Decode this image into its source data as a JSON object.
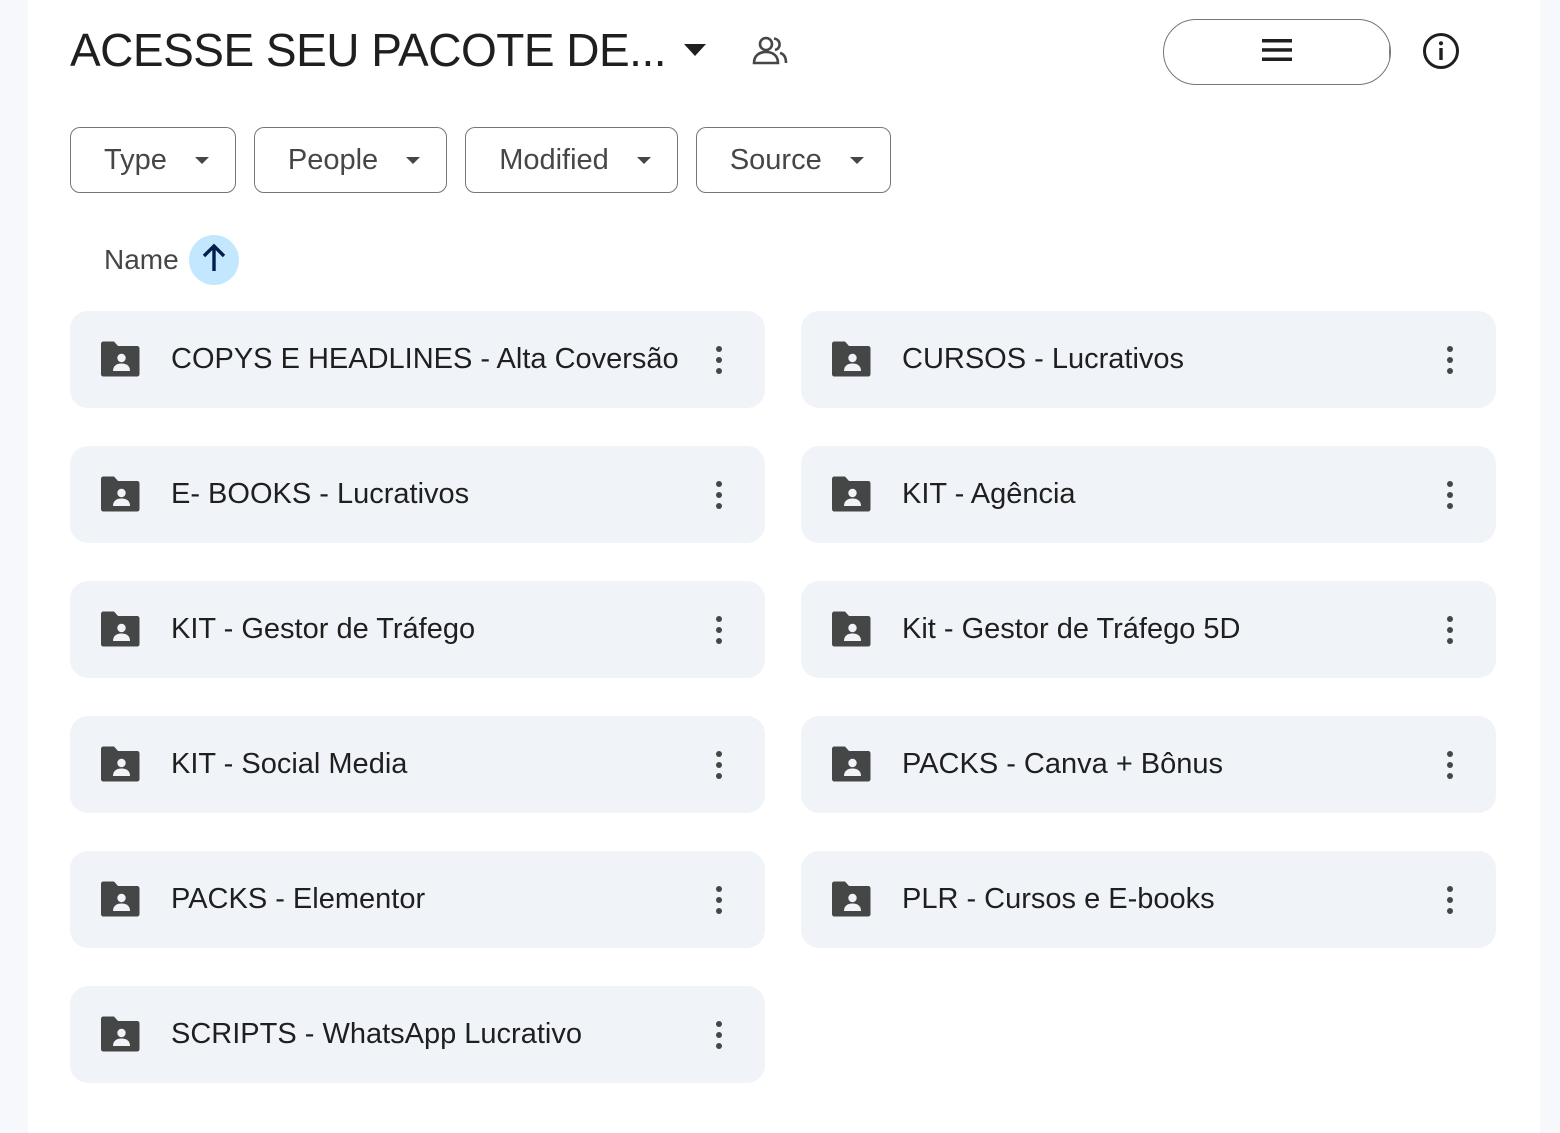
{
  "header": {
    "folder_title": "ACESSE SEU PACOTE DE...",
    "title_caret_icon": "arrow-drop-down-icon",
    "shared_icon": "people-shared-icon"
  },
  "view_toggle": {
    "list_icon": "list-view-icon",
    "grid_icon": "grid-view-icon",
    "selected": "grid",
    "selected_color": "#c2e7ff"
  },
  "info_icon": "info-icon",
  "filters": [
    {
      "label": "Type"
    },
    {
      "label": "People"
    },
    {
      "label": "Modified"
    },
    {
      "label": "Source"
    }
  ],
  "sort": {
    "label": "Name",
    "direction_icon": "arrow-upward-icon"
  },
  "folders": [
    {
      "name": "COPYS E HEADLINES - Alta Coversão"
    },
    {
      "name": "CURSOS - Lucrativos"
    },
    {
      "name": "E- BOOKS - Lucrativos"
    },
    {
      "name": "KIT - Agência"
    },
    {
      "name": "KIT - Gestor de Tráfego"
    },
    {
      "name": "Kit - Gestor de Tráfego 5D"
    },
    {
      "name": "KIT - Social Media"
    },
    {
      "name": "PACKS - Canva + Bônus"
    },
    {
      "name": "PACKS - Elementor"
    },
    {
      "name": "PLR - Cursos e E-books"
    },
    {
      "name": "SCRIPTS - WhatsApp Lucrativo"
    }
  ],
  "colors": {
    "card_bg": "#f0f4f9",
    "accent": "#0b57d0",
    "outline": "#747775"
  }
}
